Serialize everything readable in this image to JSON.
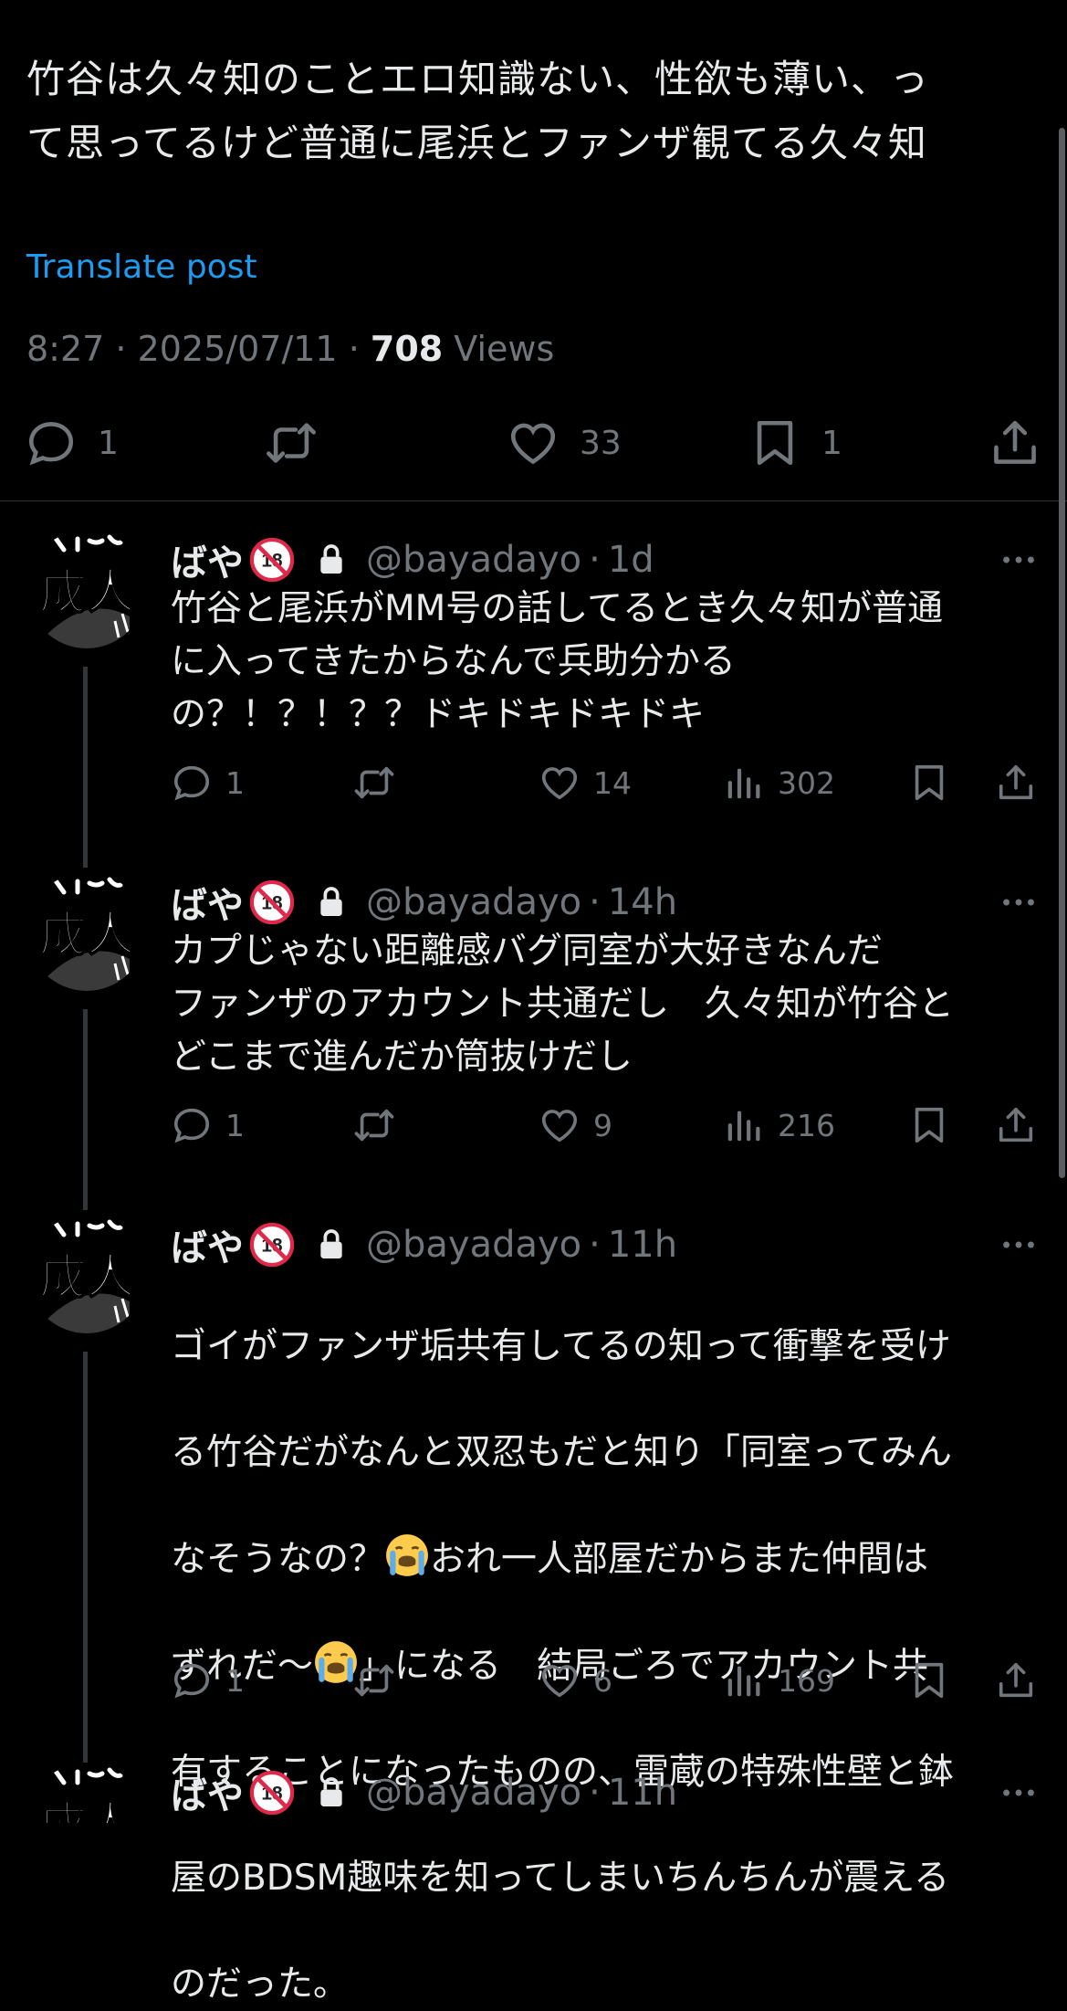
{
  "main_post": {
    "text_line1": "竹谷は久々知のことエロ知識ない、性欲も薄い、っ",
    "text_line2": "て思ってるけど普通に尾浜とファンザ観てる久々知",
    "translate_label": "Translate post",
    "time": "8:27",
    "date": "2025/07/11",
    "views_count": "708",
    "views_label": "Views",
    "actions": {
      "replies": "1",
      "reposts": "",
      "likes": "33",
      "bookmarks": "1"
    }
  },
  "replies": [
    {
      "name": "ばや",
      "handle": "@bayadayo",
      "time": "1d",
      "avatar_text": "成人",
      "text": "竹谷と尾浜がMM号の話してるとき久々知が普通\nに入ってきたからなんで兵助分かる\nの？！？！？？ドキドキドキドキ",
      "replies": "1",
      "likes": "14",
      "views": "302"
    },
    {
      "name": "ばや",
      "handle": "@bayadayo",
      "time": "14h",
      "avatar_text": "成人",
      "text": "カプじゃない距離感バグ同室が大好きなんだ\nファンザのアカウント共通だし　久々知が竹谷と\nどこまで進んだか筒抜けだし",
      "replies": "1",
      "likes": "9",
      "views": "216"
    },
    {
      "name": "ばや",
      "handle": "@bayadayo",
      "time": "11h",
      "avatar_text": "成人",
      "text_l1": "ゴイがファンザ垢共有してるの知って衝撃を受け",
      "text_l2": "る竹谷だがなんと双忍もだと知り「同室ってみん",
      "text_l3a": "なそうなの？",
      "text_l3b": "おれ一人部屋だからまた仲間は",
      "text_l4a": "ずれだ〜",
      "text_l4b": "」になる　結局ごろでアカウント共",
      "text_l5": "有することになったものの、雷蔵の特殊性壁と鉢",
      "text_l6": "屋のBDSM趣味を知ってしまいちんちんが震える",
      "text_l7": "のだった。",
      "replies": "1",
      "likes": "6",
      "views": "169"
    },
    {
      "name": "ばや",
      "handle": "@bayadayo",
      "time": "11h",
      "avatar_text": "成人"
    }
  ],
  "icons": {
    "reply": "speech-bubble-icon",
    "repost": "repost-arrows-icon",
    "like": "heart-icon",
    "views": "bar-chart-icon",
    "bookmark": "bookmark-icon",
    "share": "share-upload-icon",
    "badge": "no-under-18-icon",
    "lock": "lock-icon",
    "more": "more-dots-icon"
  },
  "colors": {
    "background": "#000000",
    "text": "#e7e9ea",
    "muted": "#71767b",
    "link": "#1d9bf0",
    "r18_red": "#e0284b"
  }
}
